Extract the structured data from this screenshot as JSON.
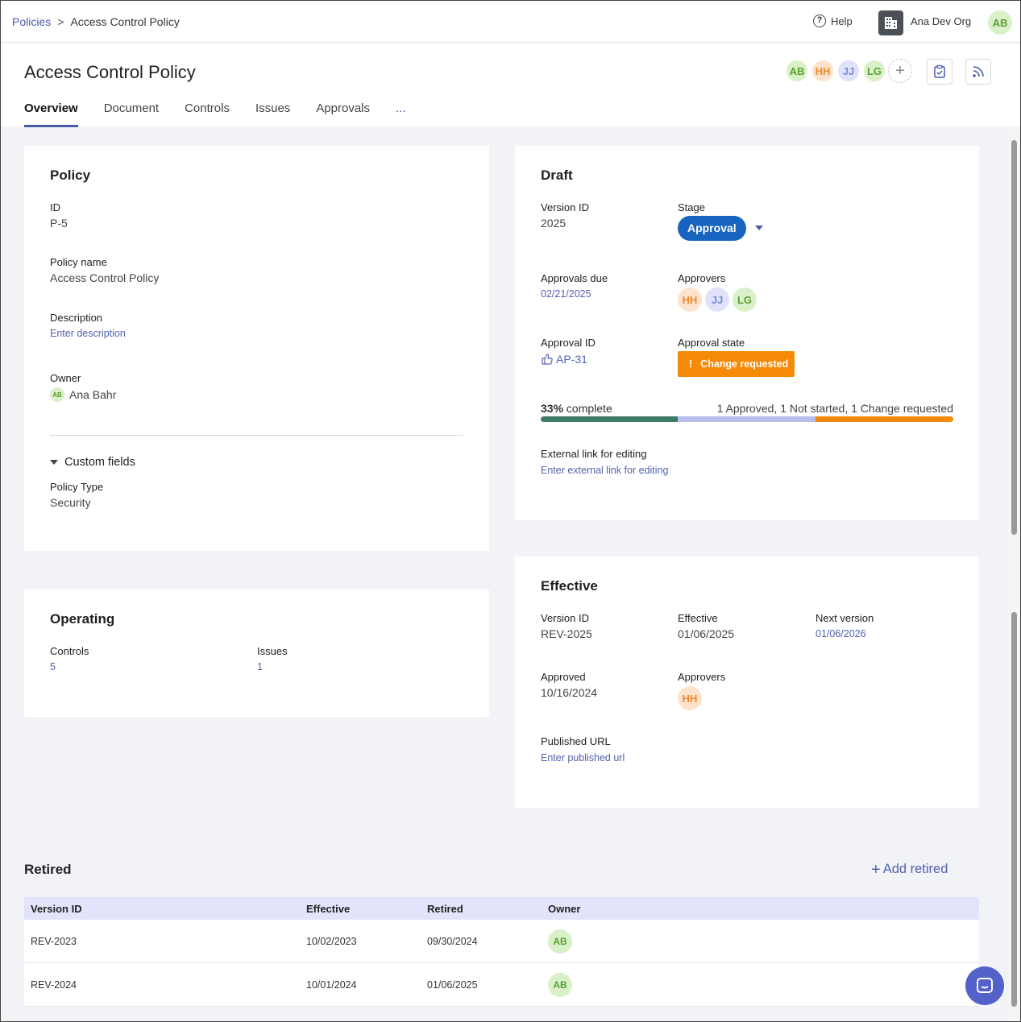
{
  "breadcrumb": {
    "parent": "Policies",
    "separator": ">",
    "current": "Access Control Policy"
  },
  "topbar": {
    "help": "Help",
    "org_name": "Ana Dev Org",
    "user_initials": "AB"
  },
  "header": {
    "title": "Access Control Policy",
    "tabs": [
      "Overview",
      "Document",
      "Controls",
      "Issues",
      "Approvals",
      "..."
    ],
    "collaborators": [
      "AB",
      "HH",
      "JJ",
      "LG"
    ]
  },
  "policy": {
    "heading": "Policy",
    "id_label": "ID",
    "id_value": "P-5",
    "name_label": "Policy name",
    "name_value": "Access Control Policy",
    "desc_label": "Description",
    "desc_placeholder": "Enter description",
    "owner_label": "Owner",
    "owner_initials": "AB",
    "owner_name": "Ana Bahr",
    "custom_fields_label": "Custom fields",
    "type_label": "Policy Type",
    "type_value": "Security"
  },
  "operating": {
    "heading": "Operating",
    "controls_label": "Controls",
    "controls_value": "5",
    "issues_label": "Issues",
    "issues_value": "1"
  },
  "draft": {
    "heading": "Draft",
    "version_label": "Version ID",
    "version_value": "2025",
    "stage_label": "Stage",
    "stage_value": "Approval",
    "due_label": "Approvals due",
    "due_value": "02/21/2025",
    "approvers_label": "Approvers",
    "approvers": [
      "HH",
      "JJ",
      "LG"
    ],
    "approval_id_label": "Approval ID",
    "approval_id_value": "AP-31",
    "state_label": "Approval state",
    "state_value": "Change requested",
    "state_icon": "!",
    "percent": "33%",
    "complete_word": "complete",
    "progress_summary": "1 Approved, 1 Not started, 1 Change requested",
    "progress_fractions": {
      "approved": 0.333,
      "not_started": 0.333,
      "change_requested": 0.334
    },
    "ext_label": "External link for editing",
    "ext_placeholder": "Enter external link for editing"
  },
  "effective": {
    "heading": "Effective",
    "version_label": "Version ID",
    "version_value": "REV-2025",
    "effective_label": "Effective",
    "effective_value": "01/06/2025",
    "next_label": "Next version",
    "next_value": "01/06/2026",
    "approved_label": "Approved",
    "approved_value": "10/16/2024",
    "approvers_label": "Approvers",
    "approvers": [
      "HH"
    ],
    "url_label": "Published URL",
    "url_placeholder": "Enter published url"
  },
  "retired": {
    "heading": "Retired",
    "add_label": "Add retired",
    "columns": [
      "Version ID",
      "Effective",
      "Retired",
      "Owner"
    ],
    "rows": [
      {
        "version": "REV-2023",
        "effective": "10/02/2023",
        "retired": "09/30/2024",
        "owner": "AB"
      },
      {
        "version": "REV-2024",
        "effective": "10/01/2024",
        "retired": "01/06/2025",
        "owner": "AB"
      }
    ]
  },
  "colors": {
    "accent": "#4a5aa8",
    "stage": "#1664c0",
    "warning": "#f58a07",
    "approved": "#3e7c68",
    "pending": "#b9bde9"
  }
}
